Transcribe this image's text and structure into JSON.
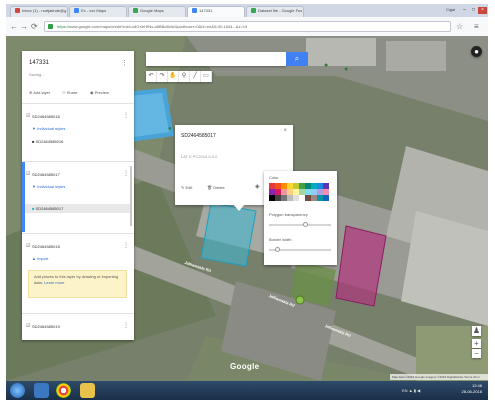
{
  "browser": {
    "tabs": [
      {
        "label": "Inbox (1) - nurtjatinde@g",
        "fav": "#d44638"
      },
      {
        "label": "Ex - xxx Maps",
        "fav": "#4285f4"
      },
      {
        "label": "Google Maps",
        "fav": "#34a853"
      },
      {
        "label": "147331",
        "fav": "#4285f4"
      },
      {
        "label": "Dataset file - Google Fus",
        "fav": "#34a853"
      }
    ],
    "window_user": "Cigal",
    "url_scheme": "https://",
    "url_rest": "www.google.com/maps/d/edit?mid=zdGXeHfNs-a8BBc8kfs0&authuser=0&hl=en&ll=30.1644...&z=19",
    "back_icon": "arrow-left-icon",
    "forward_icon": "arrow-right-icon",
    "reload_icon": "reload-icon"
  },
  "map": {
    "search_placeholder": "",
    "search_icon": "search-icon",
    "tool_icons": [
      "undo-icon",
      "redo-icon",
      "hand-icon",
      "marker-icon",
      "line-icon",
      "ruler-icon"
    ],
    "brand": "Google",
    "copyright": "Map data ©2016 Google Imagery ©2016 DigitalGlobe Terms 20 m",
    "road_labels": [
      "Jallianwala Rd",
      "Jallianwala Rd",
      "Jallianwala Rd"
    ]
  },
  "panel": {
    "title": "147331",
    "saving": "Saving...",
    "add_layer": "Add layer",
    "share": "Share",
    "preview": "Preview",
    "layers": [
      {
        "name": "SD2464585016",
        "style": "Individual styles",
        "item": "SD2464585016"
      },
      {
        "name": "SD2464585017",
        "style": "Individual styles",
        "item": "SD2464585017"
      },
      {
        "name": "SD2464585018",
        "style": "Import",
        "hint_pre": "Add places to this layer by drawing or importing data.",
        "hint_link": "Learn more"
      },
      {
        "name": "SD2464585019"
      }
    ]
  },
  "popup": {
    "title": "SD2464585017",
    "subtitle": "LAT K PC2014 0.0.0",
    "edit": "Edit",
    "delete": "Delete"
  },
  "style_panel": {
    "color_label": "Color",
    "colors": [
      "#e53935",
      "#f4511e",
      "#fb8c00",
      "#fdd835",
      "#c0ca33",
      "#43a047",
      "#00897b",
      "#00acc1",
      "#1e88e5",
      "#5e35b1",
      "#8e24aa",
      "#d81b60",
      "#ef9a9a",
      "#ffcc80",
      "#fff59d",
      "#a5d6a7",
      "#80deea",
      "#90caf9",
      "#b39ddb",
      "#f48fb1",
      "#000000",
      "#424242",
      "#757575",
      "#bdbdbd",
      "#e0e0e0",
      "#ffffff",
      "#6d4c41",
      "#a1887f",
      "#0097a7",
      "#1565c0"
    ],
    "transparency_label": "Polygon transparency",
    "transparency_value": 0.6,
    "border_label": "Border width",
    "border_value": 0.1
  },
  "taskbar": {
    "time": "12:46",
    "date": "28-06-2016",
    "lang": "EN"
  }
}
